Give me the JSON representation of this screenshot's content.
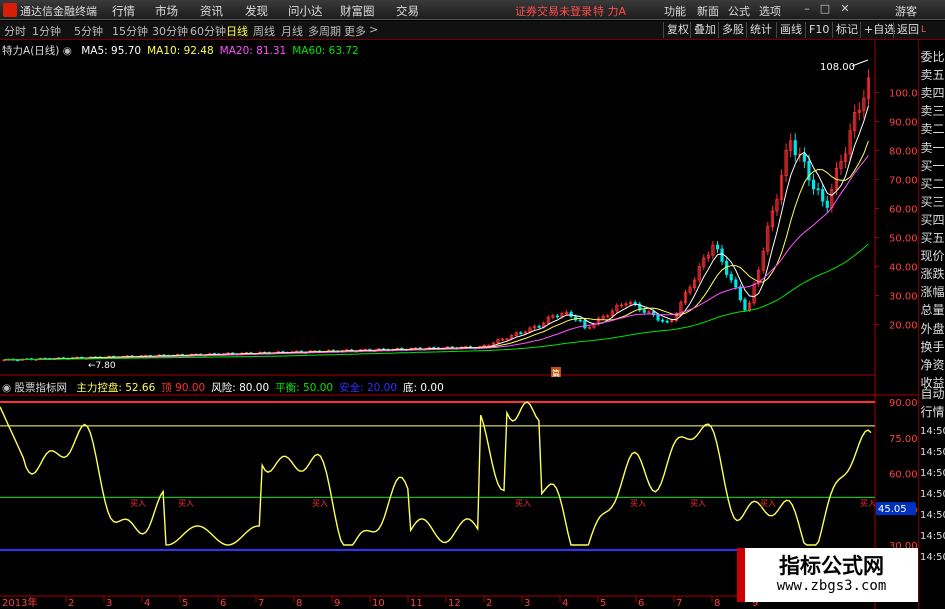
{
  "titlebar": {
    "app": "通达信金融终端",
    "menus": [
      "行情",
      "市场",
      "资讯",
      "发现",
      "问小达",
      "财富圈",
      "交易"
    ],
    "login_notice": "证券交易未登录",
    "stock_name": "特 力A",
    "right": [
      "功能",
      "新面",
      "公式",
      "选项"
    ],
    "guest": "游客"
  },
  "toolbar": {
    "timeframes": [
      "分时",
      "1分钟",
      "5分钟",
      "15分钟",
      "30分钟",
      "60分钟",
      "日线",
      "周线",
      "月线",
      "多周期",
      "更多"
    ],
    "active": "日线",
    "right_buttons": [
      "复权",
      "叠加",
      "多股",
      "统计",
      "画线",
      "F10",
      "标记",
      "+自选",
      "返回"
    ]
  },
  "main_chart": {
    "stock": "特力A",
    "period": "(日线)",
    "ma": [
      {
        "label": "MA5:",
        "value": "95.70",
        "color": "#ffffff"
      },
      {
        "label": "MA10:",
        "value": "92.48",
        "color": "#ffff54"
      },
      {
        "label": "MA20:",
        "value": "81.31",
        "color": "#ff54ff"
      },
      {
        "label": "MA60:",
        "value": "63.72",
        "color": "#00e600"
      }
    ],
    "high_label": "108.00",
    "low_label": "7.80",
    "marker": "篇",
    "y_ticks": [
      "100.0",
      "90.00",
      "80.00",
      "70.00",
      "60.00",
      "50.00",
      "40.00",
      "30.00",
      "20.00"
    ]
  },
  "indicator": {
    "name": "股票指标网",
    "items": [
      {
        "label": "主力控盘:",
        "value": "52.66",
        "color": "#ffff54"
      },
      {
        "label": "顶",
        "value": "90.00",
        "color": "#ff3030"
      },
      {
        "label": "风险:",
        "value": "80.00",
        "color": "#ffffff"
      },
      {
        "label": "平衡:",
        "value": "50.00",
        "color": "#00e600"
      },
      {
        "label": "安全:",
        "value": "20.00",
        "color": "#3030ff"
      },
      {
        "label": "底:",
        "value": "0.00",
        "color": "#ffffff"
      }
    ],
    "y_ticks": [
      "90.00",
      "75.00",
      "60.00",
      "45.00",
      "30.00"
    ],
    "current": "45.05",
    "signal": "买入"
  },
  "bottom_axis": {
    "year_label": "2013年",
    "months": [
      "2",
      "3",
      "4",
      "5",
      "6",
      "7",
      "8",
      "9",
      "10",
      "11",
      "12",
      "2",
      "3",
      "4",
      "5",
      "6",
      "7",
      "8",
      "9"
    ]
  },
  "right_panel": {
    "items": [
      "委比",
      "卖五",
      "卖四",
      "卖三",
      "卖二",
      "卖一",
      "买一",
      "买二",
      "买三",
      "买四",
      "买五",
      "现价",
      "涨跌",
      "涨幅",
      "总量",
      "外盘",
      "换手",
      "净资",
      "收益"
    ],
    "indicator_items": [
      "自动",
      "行情"
    ],
    "times": [
      "14:50",
      "14:50",
      "14:50",
      "14:50",
      "14:50",
      "14:50",
      "14:50"
    ]
  },
  "watermark": {
    "title": "指标公式网",
    "url": "www.zbgs3.com"
  }
}
